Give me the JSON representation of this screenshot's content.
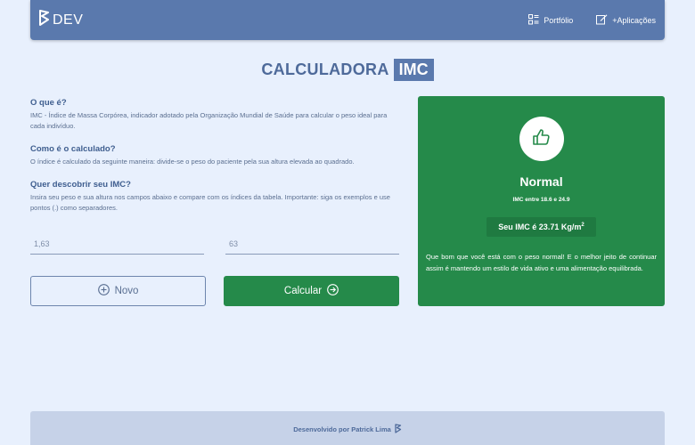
{
  "navbar": {
    "brand": "DEV",
    "links": [
      {
        "label": "Portfólio",
        "icon": "grid-list-icon"
      },
      {
        "label": "+Aplicações",
        "icon": "edit-square-icon"
      }
    ]
  },
  "title": {
    "main": "CALCULADORA",
    "badge": "IMC"
  },
  "info": {
    "sections": [
      {
        "heading": "O que é?",
        "text": "IMC - Índice de Massa Corpórea, indicador adotado pela Organização Mundial de Saúde para calcular o peso ideal para cada indivíduo."
      },
      {
        "heading": "Como é o calculado?",
        "text": "O índice é calculado da seguinte maneira: divide-se o peso do paciente pela sua altura elevada ao quadrado."
      },
      {
        "heading": "Quer descobrir seu IMC?",
        "text": "Insira seu peso e sua altura nos campos abaixo e compare com os índices da tabela. Importante: siga os exemplos e use pontos (.) como separadores."
      }
    ]
  },
  "form": {
    "height_placeholder": "1,63",
    "weight_placeholder": "63",
    "new_label": "Novo",
    "calc_label": "Calcular"
  },
  "result": {
    "icon": "thumbs-up-icon",
    "status": "Normal",
    "range": "IMC entre 18.6 e 24.9",
    "imc_prefix": "Seu IMC é 23.71 Kg/m",
    "imc_sup": "2",
    "message": "Que bom que você está com o peso normal! E o melhor jeito de continuar assim é mantendo um estilo de vida ativo e uma alimentação equilibrada.",
    "color": "#258a4a"
  },
  "footer": {
    "text": "Desenvolvido por Patrick Lima"
  },
  "colors": {
    "primary": "#5a79ad",
    "background": "#e8f0fd",
    "success": "#258a4a"
  }
}
